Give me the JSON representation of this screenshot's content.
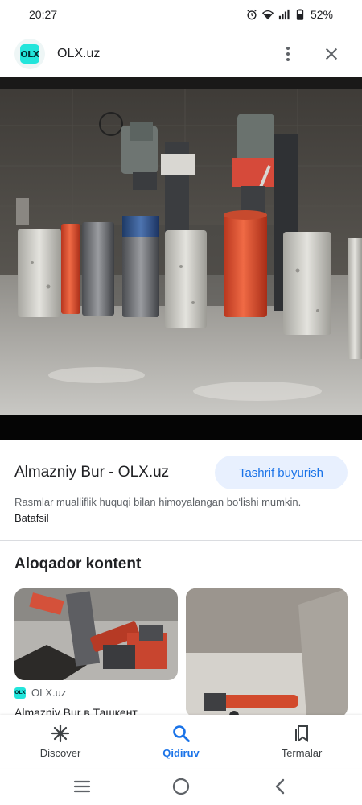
{
  "status_bar": {
    "time": "20:27",
    "battery": "52%",
    "icons": [
      "alarm-icon",
      "wifi-icon",
      "signal-icon",
      "battery-icon"
    ]
  },
  "header": {
    "logo_text": "OLX",
    "site": "OLX.uz",
    "icons": [
      "more-vert-icon",
      "close-icon"
    ]
  },
  "result": {
    "title": "Almazniy Bur - OLX.uz",
    "visit_label": "Tashrif buyurish",
    "copyright_text": "Rasmlar mualliflik huquqi bilan himoyalangan bo‘lishi mumkin.",
    "learn_more": "Batafsil"
  },
  "related": {
    "heading": "Aloqador kontent",
    "cards": [
      {
        "source": "OLX.uz",
        "title": "Almazniy Bur в Ташкент"
      }
    ]
  },
  "bottom_nav": {
    "items": [
      {
        "label": "Discover",
        "icon": "asterisk-icon"
      },
      {
        "label": "Qidiruv",
        "icon": "search-icon",
        "active": true
      },
      {
        "label": "Termalar",
        "icon": "bookmarks-icon"
      }
    ]
  },
  "system_nav": {
    "icons": [
      "recents-icon",
      "home-icon",
      "back-icon"
    ]
  },
  "colors": {
    "accent": "#1a73e8",
    "accent_bg": "#e8f0fe",
    "olx_teal": "#23e5db",
    "text_primary": "#202124",
    "text_secondary": "#5f6368"
  }
}
